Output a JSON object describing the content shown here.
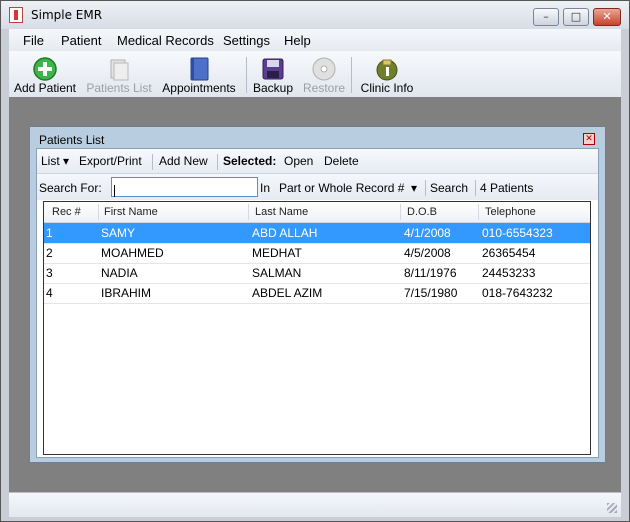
{
  "app": {
    "title": "Simple EMR"
  },
  "menu": [
    "File",
    "Patient",
    "Medical Records",
    "Settings",
    "Help"
  ],
  "toolbar": {
    "add_patient": "Add Patient",
    "patients_list": "Patients List",
    "appointments": "Appointments",
    "backup": "Backup",
    "restore": "Restore",
    "clinic_info": "Clinic Info"
  },
  "child_window": {
    "title": "Patients List",
    "toolbar": {
      "list": "List",
      "export": "Export/Print",
      "add_new": "Add New",
      "selected": "Selected:",
      "open": "Open",
      "delete": "Delete"
    },
    "search": {
      "label": "Search For:",
      "value": "",
      "in_label": "In",
      "field": "Part or Whole Record #",
      "button": "Search",
      "count": "4 Patients"
    }
  },
  "grid": {
    "columns": [
      "Rec #",
      "First Name",
      "Last Name",
      "D.O.B",
      "Telephone"
    ],
    "rows": [
      [
        "1",
        "SAMY",
        "ABD ALLAH",
        "4/1/2008",
        "010-6554323"
      ],
      [
        "2",
        "MOAHMED",
        "MEDHAT",
        "4/5/2008",
        "26365454"
      ],
      [
        "3",
        "NADIA",
        "SALMAN",
        "8/11/1976",
        "24453233"
      ],
      [
        "4",
        "IBRAHIM",
        "ABDEL AZIM",
        "7/15/1980",
        "018-7643232"
      ]
    ],
    "selected_row": 0
  },
  "colors": {
    "selection": "#3399ff",
    "mdi_background": "#808080"
  }
}
